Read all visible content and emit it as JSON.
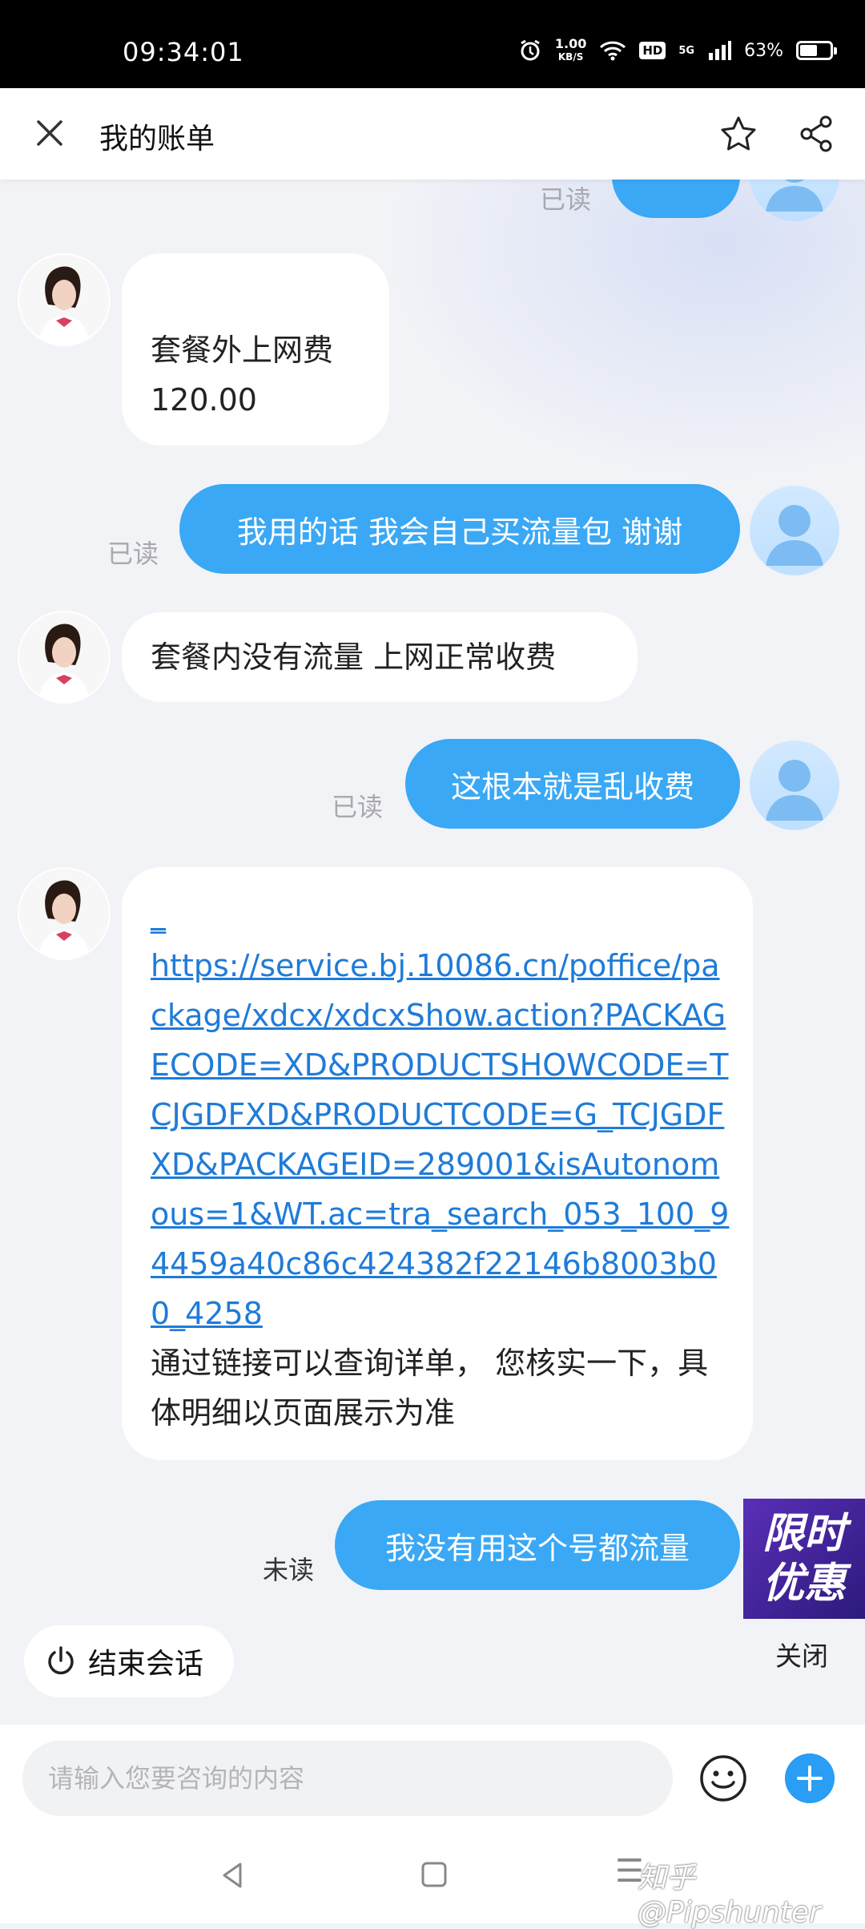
{
  "status_bar": {
    "time": "09:34:01",
    "speed_value": "1.00",
    "speed_unit": "KB/S",
    "hd": "HD",
    "network": "5G",
    "battery": "63%",
    "battery_level": 0.63
  },
  "header": {
    "title": "我的账单",
    "close_icon": "close-icon",
    "favorite_icon": "star-icon",
    "share_icon": "share-icon"
  },
  "messages": [
    {
      "sender": "user",
      "text": "",
      "status": "已读"
    },
    {
      "sender": "agent",
      "lines": [
        "套餐外上网费",
        "120.00"
      ]
    },
    {
      "sender": "user",
      "text": "我用的话 我会自己买流量包 谢谢",
      "status": "已读"
    },
    {
      "sender": "agent",
      "text": "套餐内没有流量 上网正常收费"
    },
    {
      "sender": "user",
      "text": "这根本就是乱收费",
      "status": "已读"
    },
    {
      "sender": "agent",
      "link_lead": "_",
      "link": "https://service.bj.10086.cn/poffice/package/xdcx/xdcxShow.action?PACKAGECODE=XD&PRODUCTSHOWCODE=TCJGDFXD&PRODUCTCODE=G_TCJGDFXD&PACKAGEID=289001&isAutonomous=1&WT.ac=tra_search_053_100_94459a40c86c424382f22146b8003b00_4258",
      "text": "通过链接可以查询详单， 您核实一下，具体明细以页面展示为准"
    },
    {
      "sender": "user",
      "text": "我没有用这个号都流量",
      "status": "未读"
    }
  ],
  "end_session": {
    "label": "结束会话",
    "icon": "power-icon"
  },
  "promo": {
    "line1": "限时",
    "line2": "优惠",
    "close_label": "关闭",
    "color": "#4a2aa8"
  },
  "input": {
    "placeholder": "请输入您要咨询的内容",
    "value": "",
    "emoji_icon": "emoji-icon",
    "plus_icon": "plus-icon"
  },
  "colors": {
    "user_bubble": "#3aa8f5",
    "link": "#1f7bd8",
    "accent": "#2a9df4"
  },
  "nav": {
    "watermark": "知乎 @Pipshunter"
  }
}
